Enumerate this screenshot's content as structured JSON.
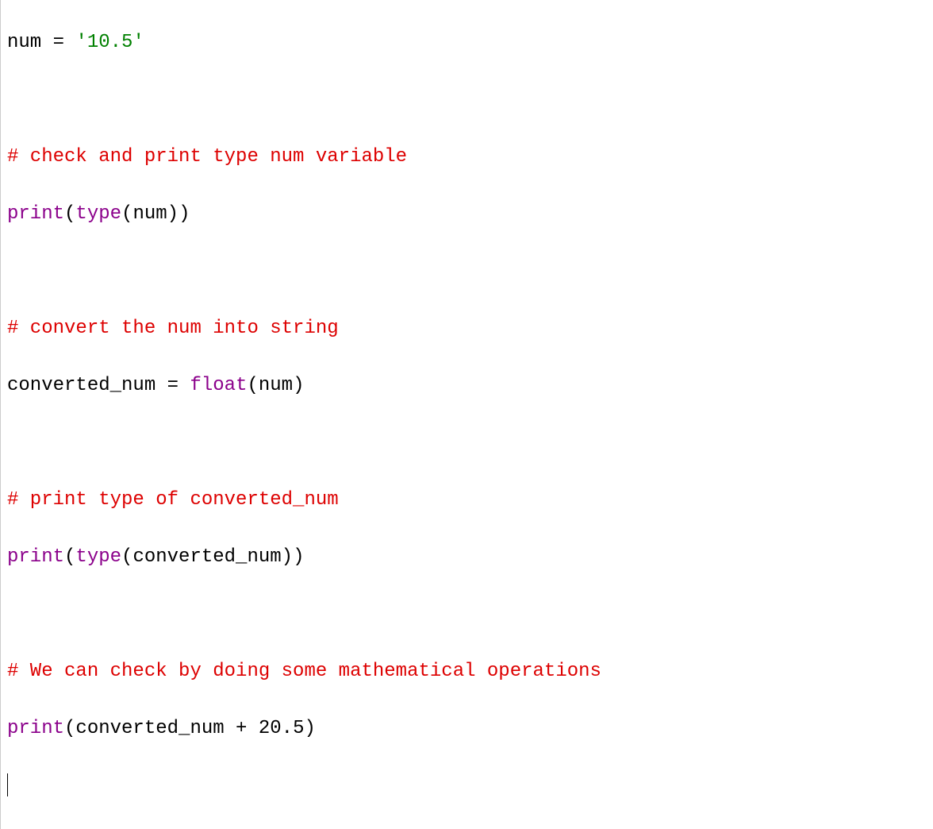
{
  "code": {
    "line1": {
      "var": "num",
      "eq": " = ",
      "str": "'10.5'"
    },
    "line3_comment": "# check and print type num variable",
    "line4": {
      "print": "print",
      "lp1": "(",
      "type": "type",
      "lp2": "(",
      "arg": "num",
      "rp2": ")",
      "rp1": ")"
    },
    "line6_comment": "# convert the num into string",
    "line7": {
      "var": "converted_num",
      "eq": " = ",
      "func": "float",
      "lp": "(",
      "arg": "num",
      "rp": ")"
    },
    "line9_comment": "# print type of converted_num",
    "line10": {
      "print": "print",
      "lp1": "(",
      "type": "type",
      "lp2": "(",
      "arg": "converted_num",
      "rp2": ")",
      "rp1": ")"
    },
    "line12_comment": "# We can check by doing some mathematical operations",
    "line13": {
      "print": "print",
      "lp": "(",
      "arg": "converted_num",
      "plus": " + ",
      "num": "20.5",
      "rp": ")"
    }
  }
}
